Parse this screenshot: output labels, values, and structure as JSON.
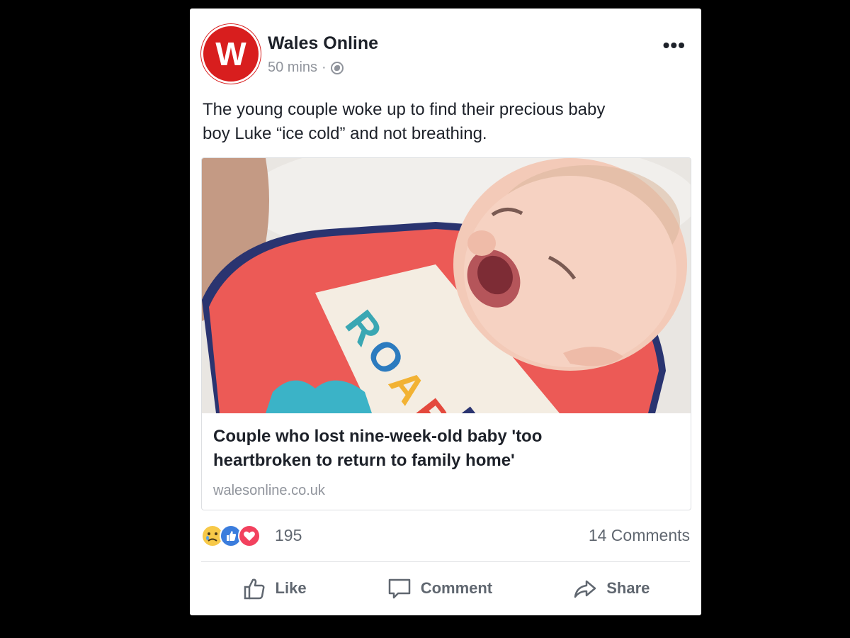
{
  "post": {
    "page_name": "Wales Online",
    "avatar_letter": "W",
    "timestamp": "50 mins",
    "separator": "·",
    "text_line1": "The young couple woke up to find their precious baby",
    "text_line2": "boy Luke “ice cold” and not breathing."
  },
  "link": {
    "title_line1": "Couple who lost nine-week-old baby 'too",
    "title_line2": "heartbroken to return to family home'",
    "domain": "walesonline.co.uk",
    "bib_text": "BIG ROARR"
  },
  "stats": {
    "reaction_count": "195",
    "comments": "14 Comments"
  },
  "actions": {
    "like": "Like",
    "comment": "Comment",
    "share": "Share"
  },
  "colors": {
    "brand_red": "#d81e1e",
    "text_primary": "#1d2129",
    "text_secondary": "#90949c"
  }
}
